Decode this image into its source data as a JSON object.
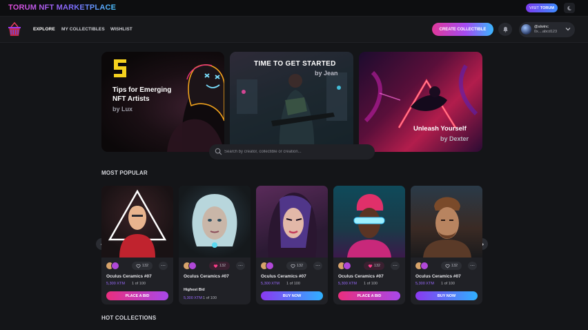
{
  "topbar": {
    "brand": "TORUM NFT MARKETPLACE",
    "visit_prefix": "VISIT",
    "visit_brand": "TORUM"
  },
  "nav": {
    "items": [
      "EXPLORE",
      "MY COLLECTIBLES",
      "WISHLIST"
    ],
    "create_label": "CREATE COLLECTIBLE",
    "user": {
      "handle": "@alwinc",
      "address": "0x....abcd123"
    }
  },
  "banners": [
    {
      "badge": "5",
      "title": "Tips for Emerging NFT Artists",
      "by": "by Lux"
    },
    {
      "title": "TIME TO GET STARTED",
      "by": "by Jean"
    },
    {
      "title": "Unleash Yourself",
      "by": "by Dexter"
    }
  ],
  "search": {
    "placeholder": "Search by creator, collectible or creation..."
  },
  "sections": {
    "popular": "MOST POPULAR",
    "hot": "HOT COLLECTIONS"
  },
  "cards": [
    {
      "name": "Oculus Ceramics #07",
      "price": "5,300 XTM",
      "edition": "1 of 100",
      "likes": "132",
      "liked": false,
      "button": "PLACE A BID",
      "button_style": "bid"
    },
    {
      "name": "Oculus Ceramics #07",
      "bid_label": "Highest Bid",
      "price": "5,300 XTM",
      "edition": "1 of 100",
      "likes": "132",
      "liked": true
    },
    {
      "name": "Oculus Ceramics #07",
      "price": "5,300 XTM",
      "edition": "1 of 100",
      "likes": "132",
      "liked": false,
      "button": "BUY NOW",
      "button_style": "buy"
    },
    {
      "name": "Oculus Ceramics #07",
      "price": "5,300 XTM",
      "edition": "1 of 100",
      "likes": "132",
      "liked": true,
      "button": "PLACE A BID",
      "button_style": "bid"
    },
    {
      "name": "Oculus Ceramics #07",
      "price": "5,300 XTM",
      "edition": "1 of 100",
      "likes": "132",
      "liked": false,
      "button": "BUY NOW",
      "button_style": "buy"
    }
  ],
  "colors": {
    "accent_pink": "#ea2e7e",
    "accent_purple": "#9b6bff",
    "accent_blue": "#2fb0ff",
    "background": "#141518"
  }
}
